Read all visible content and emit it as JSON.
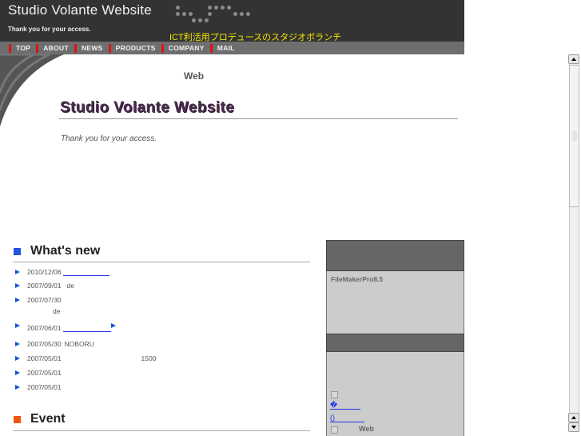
{
  "header": {
    "site_title": "Studio Volante Website",
    "subtitle": "Thank you for your access.",
    "catchphrase": "ICT利活用プロデュースのスタジオボランチ"
  },
  "nav": {
    "items": [
      {
        "label": "TOP"
      },
      {
        "label": "ABOUT"
      },
      {
        "label": "NEWS"
      },
      {
        "label": "PRODUCTS"
      },
      {
        "label": "COMPANY"
      },
      {
        "label": "MAIL"
      }
    ]
  },
  "hero": {
    "caption": "Web",
    "title": "Studio Volante Website",
    "tagline": "Thank you for your access."
  },
  "whats_new": {
    "title": "What's new",
    "items": [
      {
        "date": "2010/12/06",
        "text": ""
      },
      {
        "date": "2007/09/01",
        "text": "de"
      },
      {
        "date": "2007/07/30",
        "text": "de"
      },
      {
        "date": "2007/06/01",
        "text": ""
      },
      {
        "date": "2007/05/30",
        "text": "NOBORU"
      },
      {
        "date": "2007/05/01",
        "text": "1500"
      },
      {
        "date": "2007/05/01",
        "text": ""
      },
      {
        "date": "2007/05/01",
        "text": ""
      }
    ]
  },
  "event": {
    "title": "Event"
  },
  "sidebar": {
    "product_text": "FileMakerPro8.5",
    "link1": "�",
    "link2": "()",
    "web_label": "Web"
  },
  "colors": {
    "header_bg": "#333333",
    "nav_bg": "#6e6e6e",
    "nav_separator": "#e01010",
    "catch_yellow": "#f5e600",
    "title_purple": "#4d2a52",
    "whats_new_square": "#2255dd",
    "event_square": "#ee5511",
    "link_blue": "#2233ee"
  }
}
